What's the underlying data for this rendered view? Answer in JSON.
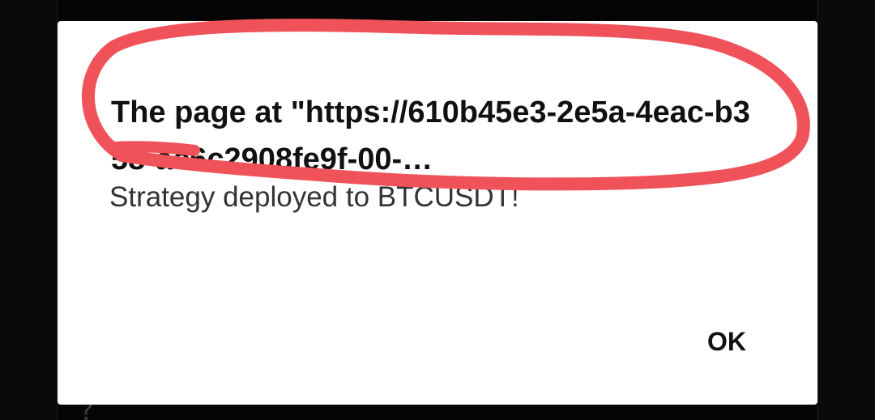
{
  "dialog": {
    "title": "The page at \"https://610b45e3-2e5a-4eac-b358-ac6c2908fe9f-00-…",
    "message": "Strategy deployed to BTCUSDT!",
    "ok_label": "OK"
  },
  "background": {
    "glyph_bottom": "?"
  },
  "colors": {
    "annotation_stroke": "#f0525a",
    "dialog_background": "#ffffff",
    "backdrop": "#000000"
  }
}
